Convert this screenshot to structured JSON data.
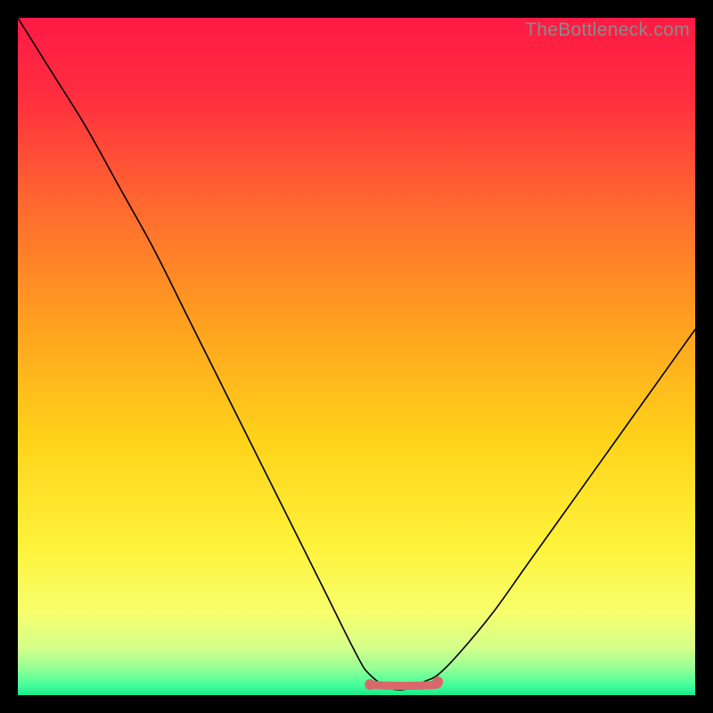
{
  "watermark": {
    "text": "TheBottleneck.com"
  },
  "chart_data": {
    "type": "line",
    "title": "",
    "xlabel": "",
    "ylabel": "",
    "xlim": [
      0,
      100
    ],
    "ylim": [
      0,
      100
    ],
    "grid": false,
    "legend": false,
    "series": [
      {
        "name": "curve",
        "x": [
          0,
          5,
          10,
          15,
          20,
          25,
          30,
          35,
          40,
          45,
          50,
          52,
          55,
          58,
          60,
          62,
          65,
          70,
          75,
          80,
          85,
          90,
          95,
          100
        ],
        "y": [
          100,
          92,
          84,
          75,
          66,
          56,
          46,
          36,
          26,
          16,
          6,
          3,
          1,
          1,
          2,
          3,
          6,
          12,
          19,
          26,
          33,
          40,
          47,
          54
        ]
      },
      {
        "name": "highlight-band",
        "x": [
          52,
          62
        ],
        "y": [
          1,
          1
        ]
      }
    ],
    "background_gradient": {
      "stops": [
        {
          "offset": 0.0,
          "color": "#ff1a44"
        },
        {
          "offset": 0.12,
          "color": "#ff2f3f"
        },
        {
          "offset": 0.28,
          "color": "#ff6a2f"
        },
        {
          "offset": 0.45,
          "color": "#ffa01f"
        },
        {
          "offset": 0.62,
          "color": "#ffd21a"
        },
        {
          "offset": 0.78,
          "color": "#fff23a"
        },
        {
          "offset": 0.88,
          "color": "#f6ff6e"
        },
        {
          "offset": 0.93,
          "color": "#d4ff8a"
        },
        {
          "offset": 0.96,
          "color": "#96ff96"
        },
        {
          "offset": 0.985,
          "color": "#45ff9a"
        },
        {
          "offset": 1.0,
          "color": "#18e88c"
        }
      ]
    },
    "curve_style": {
      "color": "#000000",
      "width": 1.6
    },
    "highlight_style": {
      "color": "#d9686a",
      "width": 9,
      "dot_radius": 6
    }
  }
}
